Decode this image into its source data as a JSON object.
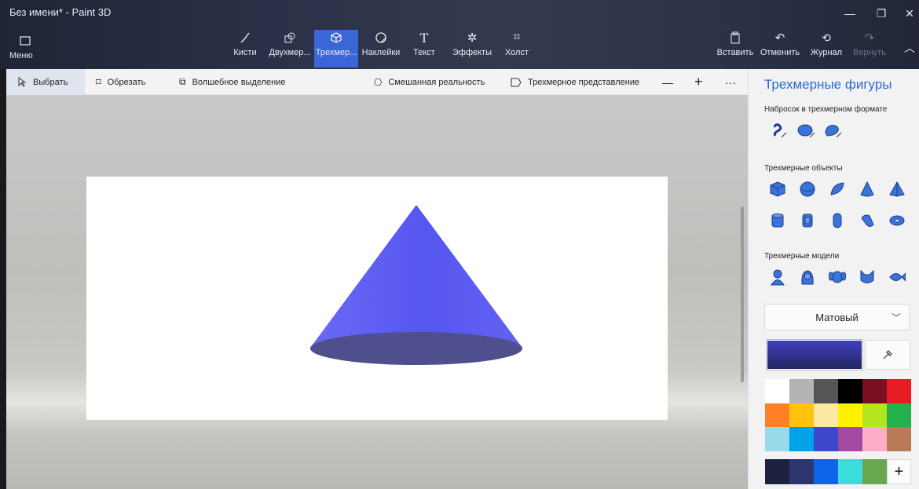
{
  "window": {
    "title": "Без имени* - Paint 3D"
  },
  "ribbon": {
    "menu": "Меню",
    "tools": [
      {
        "label": "Кисти"
      },
      {
        "label": "Двухмер..."
      },
      {
        "label": "Трехмер..."
      },
      {
        "label": "Наклейки"
      },
      {
        "label": "Текст"
      },
      {
        "label": "Эффекты"
      },
      {
        "label": "Холст"
      }
    ],
    "right": [
      {
        "label": "Вставить"
      },
      {
        "label": "Отменить"
      },
      {
        "label": "Журнал"
      },
      {
        "label": "Вернуть"
      }
    ]
  },
  "toolbar": {
    "select": "Выбрать",
    "crop": "Обрезать",
    "magic_select": "Волшебное выделение",
    "mixed_reality": "Смешанная реальность",
    "view_3d": "Трехмерное представление",
    "zoom_out": "—",
    "zoom_in": "+",
    "more": "···"
  },
  "panel": {
    "title": "Трехмерные фигуры",
    "doodle_section": "Набросок в трехмерном формате",
    "objects_section": "Трехмерные объекты",
    "models_section": "Трехмерные модели",
    "material": "Матовый",
    "current_color": "#3f3fc0",
    "palette": [
      "#ffffff",
      "#b4b4b4",
      "#555555",
      "#000000",
      "#7a0f22",
      "#e81d24",
      "#ff7f27",
      "#ffc20e",
      "#fde8a3",
      "#fff200",
      "#b5e61d",
      "#22b14c",
      "#99d9ea",
      "#00a2e8",
      "#3f48cc",
      "#a349a4",
      "#ffaec9",
      "#b97a57"
    ],
    "custom_colors": [
      "#1d2140",
      "#2e3470",
      "#0f63e8",
      "#3cdcdc",
      "#6aa84f"
    ],
    "add_label": "+"
  },
  "scene": {
    "object": "cone",
    "color": "#5a5af2"
  }
}
